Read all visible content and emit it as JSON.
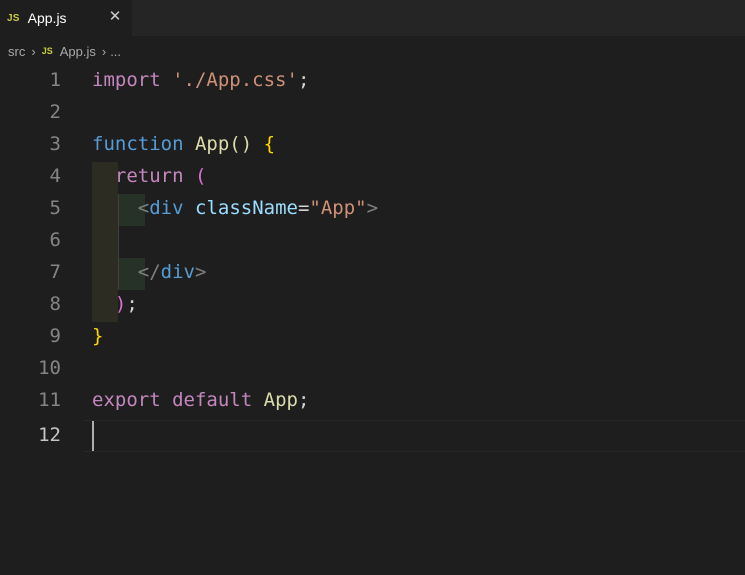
{
  "tab": {
    "icon_label": "JS",
    "filename": "App.js",
    "close_glyph": "✕"
  },
  "breadcrumb": {
    "folder": "src",
    "sep": "›",
    "icon_label": "JS",
    "file": "App.js",
    "ellipsis": "..."
  },
  "editor": {
    "line_numbers": [
      "1",
      "2",
      "3",
      "4",
      "5",
      "6",
      "7",
      "8",
      "9",
      "10",
      "11",
      "12"
    ],
    "active_line": 12,
    "line1": {
      "import": "import",
      "path": "'./App.css'",
      "semi": ";"
    },
    "line3": {
      "function": "function",
      "name": "App",
      "parens": "()",
      "brace": "{"
    },
    "line4": {
      "return": "return",
      "paren": "("
    },
    "line5": {
      "open": "<",
      "tag": "div",
      "attr": "className",
      "eq": "=",
      "value": "\"App\"",
      "close": ">"
    },
    "line7": {
      "open": "</",
      "tag": "div",
      "close": ">"
    },
    "line8": {
      "paren": ")",
      "semi": ";"
    },
    "line9": {
      "brace": "}"
    },
    "line11": {
      "export": "export",
      "default": "default",
      "name": "App",
      "semi": ";"
    }
  },
  "colors": {
    "keyword": "#c586c0",
    "storage": "#569cd6",
    "function": "#dcdcaa",
    "string": "#ce9178",
    "bracket1": "#ffd700",
    "bracket2": "#da70d6"
  }
}
